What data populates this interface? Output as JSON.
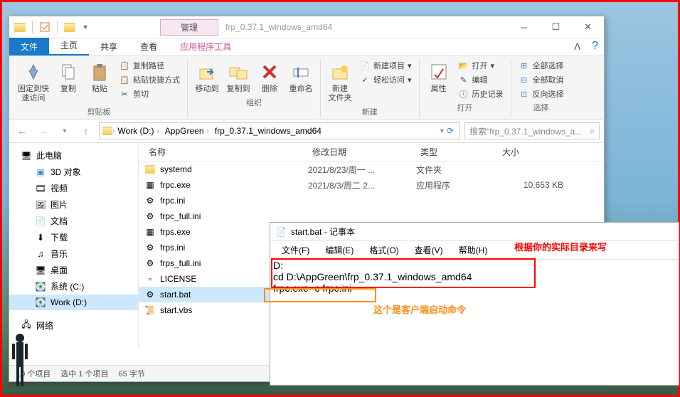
{
  "explorer": {
    "title_path": "frp_0.37.1_windows_amd64",
    "manage_tab": "管理",
    "tabs": {
      "file": "文件",
      "home": "主页",
      "share": "共享",
      "view": "查看",
      "app_tools": "应用程序工具"
    },
    "ribbon": {
      "pin": "固定到快\n速访问",
      "copy": "复制",
      "paste": "粘贴",
      "copy_path": "复制路径",
      "paste_shortcut": "粘贴快捷方式",
      "cut": "剪切",
      "group_clipboard": "剪贴板",
      "move_to": "移动到",
      "copy_to": "复制到",
      "delete": "删除",
      "rename": "重命名",
      "group_organize": "组织",
      "new_folder": "新建\n文件夹",
      "new_item": "新建项目",
      "easy_access": "轻松访问",
      "group_new": "新建",
      "properties": "属性",
      "open": "打开",
      "edit": "编辑",
      "history": "历史记录",
      "group_open": "打开",
      "select_all": "全部选择",
      "select_none": "全部取消",
      "invert_sel": "反向选择",
      "group_select": "选择"
    },
    "path": {
      "seg1": "Work (D:)",
      "seg2": "AppGreen",
      "seg3": "frp_0.37.1_windows_amd64"
    },
    "search_placeholder": "搜索\"frp_0.37.1_windows_a...",
    "nav": {
      "this_pc": "此电脑",
      "objects_3d": "3D 对象",
      "videos": "视频",
      "pictures": "图片",
      "documents": "文档",
      "downloads": "下载",
      "music": "音乐",
      "desktop": "桌面",
      "system_c": "系统 (C:)",
      "work_d": "Work (D:)",
      "network": "网络"
    },
    "columns": {
      "name": "名称",
      "date": "修改日期",
      "type": "类型",
      "size": "大小"
    },
    "files": [
      {
        "name": "systemd",
        "date": "2021/8/23/周一 ...",
        "type": "文件夹",
        "size": "",
        "icon": "folder"
      },
      {
        "name": "frpc.exe",
        "date": "2021/8/3/周二 2...",
        "type": "应用程序",
        "size": "10,653 KB",
        "icon": "exe"
      },
      {
        "name": "frpc.ini",
        "date": "",
        "type": "",
        "size": "",
        "icon": "ini"
      },
      {
        "name": "frpc_full.ini",
        "date": "",
        "type": "",
        "size": "",
        "icon": "ini"
      },
      {
        "name": "frps.exe",
        "date": "",
        "type": "",
        "size": "",
        "icon": "exe"
      },
      {
        "name": "frps.ini",
        "date": "",
        "type": "",
        "size": "",
        "icon": "ini"
      },
      {
        "name": "frps_full.ini",
        "date": "",
        "type": "",
        "size": "",
        "icon": "ini"
      },
      {
        "name": "LICENSE",
        "date": "",
        "type": "",
        "size": "",
        "icon": "file"
      },
      {
        "name": "start.bat",
        "date": "",
        "type": "",
        "size": "",
        "icon": "bat",
        "selected": true
      },
      {
        "name": "start.vbs",
        "date": "",
        "type": "",
        "size": "",
        "icon": "vbs"
      }
    ],
    "status": {
      "count": "10 个项目",
      "selected": "选中 1 个项目",
      "bytes": "65 字节"
    }
  },
  "notepad": {
    "title": "start.bat - 记事本",
    "menu": {
      "file": "文件(F)",
      "edit": "编辑(E)",
      "format": "格式(O)",
      "view": "查看(V)",
      "help": "帮助(H)"
    },
    "line1": "D:",
    "line2": "cd D:\\AppGreen\\frp_0.37.1_windows_amd64",
    "line3": "frpc.exe -c frpc.ini"
  },
  "annotations": {
    "red": "根据你的实际目录来写",
    "orange": "这个是客户端启动命令"
  }
}
